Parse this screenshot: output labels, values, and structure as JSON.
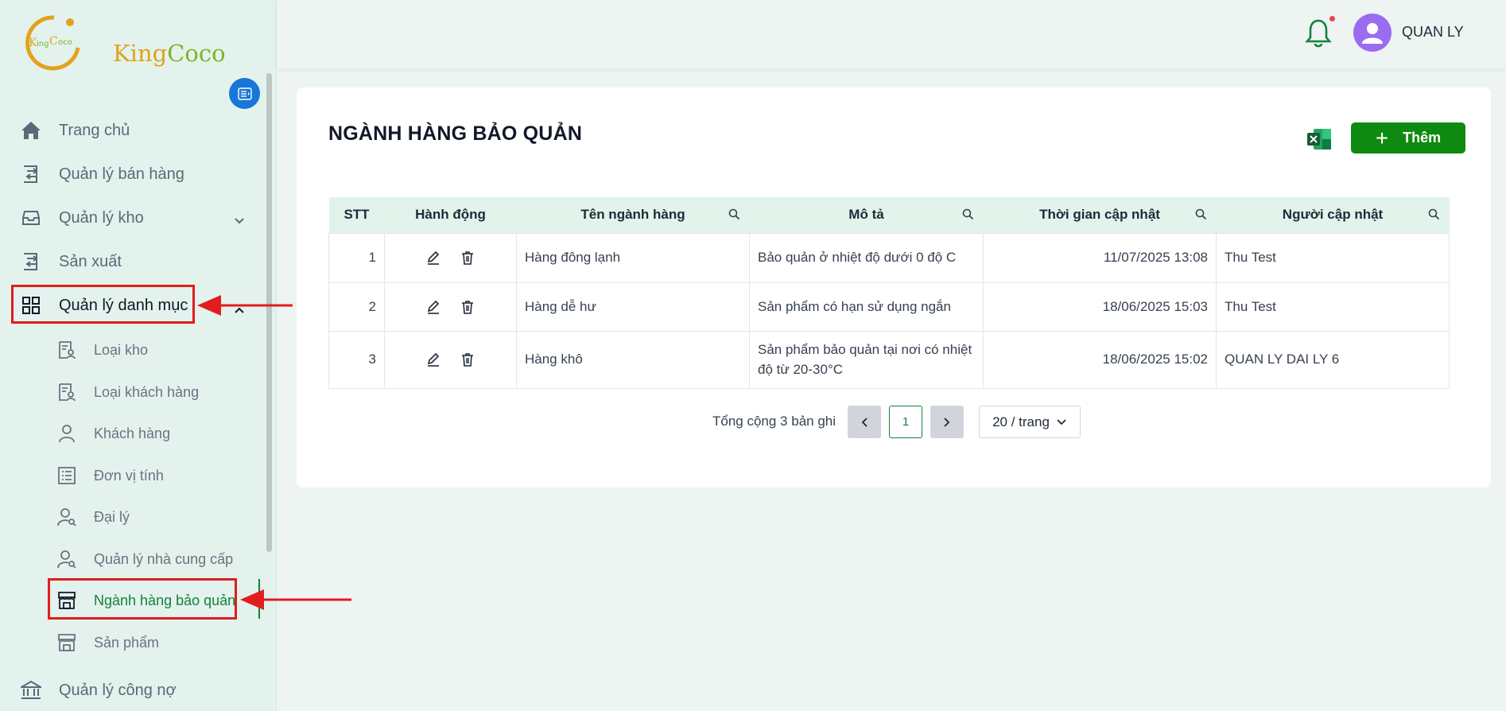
{
  "app": {
    "logo_text_a": "King",
    "logo_text_b": "Coco"
  },
  "header": {
    "user_name": "QUAN LY"
  },
  "sidebar": {
    "items": [
      {
        "label": "Trang chủ"
      },
      {
        "label": "Quản lý bán hàng"
      },
      {
        "label": "Quản lý kho"
      },
      {
        "label": "Sản xuất"
      },
      {
        "label": "Quản lý danh mục"
      },
      {
        "label": "Quản lý công nợ"
      }
    ],
    "sub_items": [
      {
        "label": "Loại kho"
      },
      {
        "label": "Loại khách hàng"
      },
      {
        "label": "Khách hàng"
      },
      {
        "label": "Đơn vị tính"
      },
      {
        "label": "Đại lý"
      },
      {
        "label": "Quản lý nhà cung cấp"
      },
      {
        "label": "Ngành hàng bảo quản"
      },
      {
        "label": "Sản phẩm"
      }
    ]
  },
  "main": {
    "title": "NGÀNH HÀNG BẢO QUẢN",
    "add_label": "Thêm",
    "columns": [
      "STT",
      "Hành động",
      "Tên ngành hàng",
      "Mô tả",
      "Thời gian cập nhật",
      "Người cập nhật"
    ],
    "rows": [
      {
        "stt": "1",
        "name": "Hàng đông lạnh",
        "desc": "Bảo quản ở nhiệt độ dưới 0 độ C",
        "time": "11/07/2025 13:08",
        "user": "Thu Test"
      },
      {
        "stt": "2",
        "name": "Hàng dễ hư",
        "desc": "Sản phẩm có hạn sử dụng ngắn",
        "time": "18/06/2025 15:03",
        "user": "Thu Test"
      },
      {
        "stt": "3",
        "name": "Hàng khô",
        "desc": "Sản phẩm bảo quản tại nơi có nhiệt độ từ 20-30°C",
        "time": "18/06/2025 15:02",
        "user": "QUAN LY DAI LY 6"
      }
    ],
    "pagination": {
      "total": "Tổng cộng 3 bản ghi",
      "current_page": "1",
      "page_size": "20 / trang"
    }
  },
  "colors": {
    "primary": "#0f8a10",
    "sidebar_bg": "#e3f2ed",
    "header_row_bg": "#e1f3eb",
    "annotation": "#e11d1d"
  }
}
